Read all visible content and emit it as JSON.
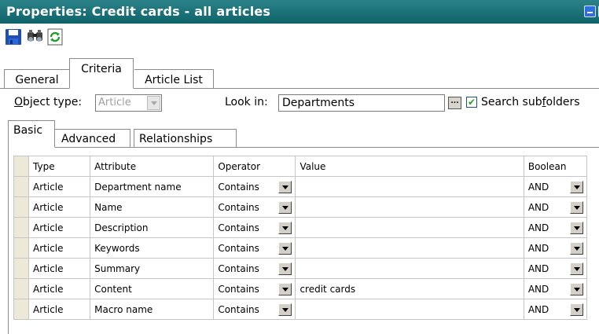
{
  "window": {
    "title": "Properties: Credit cards - all articles"
  },
  "toolbar": {
    "icons": [
      "save-icon",
      "find-icon",
      "refresh-icon"
    ]
  },
  "tabs": {
    "general": "General",
    "criteria": "Criteria",
    "article_list": "Article List"
  },
  "criteria": {
    "object_type_label_prefix": "O",
    "object_type_label_rest": "bject type:",
    "object_type_value": "Article",
    "look_in_label": "Look in:",
    "look_in_value": "Departments",
    "browse_label": "...",
    "search_subfolders_checked": true,
    "search_subfolders_label_a": "Search sub",
    "search_subfolders_label_f": "f",
    "search_subfolders_label_b": "olders"
  },
  "subtabs": {
    "basic": "Basic",
    "advanced": "Advanced",
    "relationships": "Relationships"
  },
  "grid": {
    "headers": {
      "type": "Type",
      "attribute": "Attribute",
      "operator": "Operator",
      "value": "Value",
      "boolean": "Boolean"
    },
    "rows": [
      {
        "type": "Article",
        "attribute": "Department name",
        "operator": "Contains",
        "value": "",
        "boolean": "AND"
      },
      {
        "type": "Article",
        "attribute": "Name",
        "operator": "Contains",
        "value": "",
        "boolean": "AND"
      },
      {
        "type": "Article",
        "attribute": "Description",
        "operator": "Contains",
        "value": "",
        "boolean": "AND"
      },
      {
        "type": "Article",
        "attribute": "Keywords",
        "operator": "Contains",
        "value": "",
        "boolean": "AND"
      },
      {
        "type": "Article",
        "attribute": "Summary",
        "operator": "Contains",
        "value": "",
        "boolean": "AND"
      },
      {
        "type": "Article",
        "attribute": "Content",
        "operator": "Contains",
        "value": "credit cards",
        "boolean": "AND"
      },
      {
        "type": "Article",
        "attribute": "Macro name",
        "operator": "Contains",
        "value": "",
        "boolean": "AND"
      }
    ]
  }
}
